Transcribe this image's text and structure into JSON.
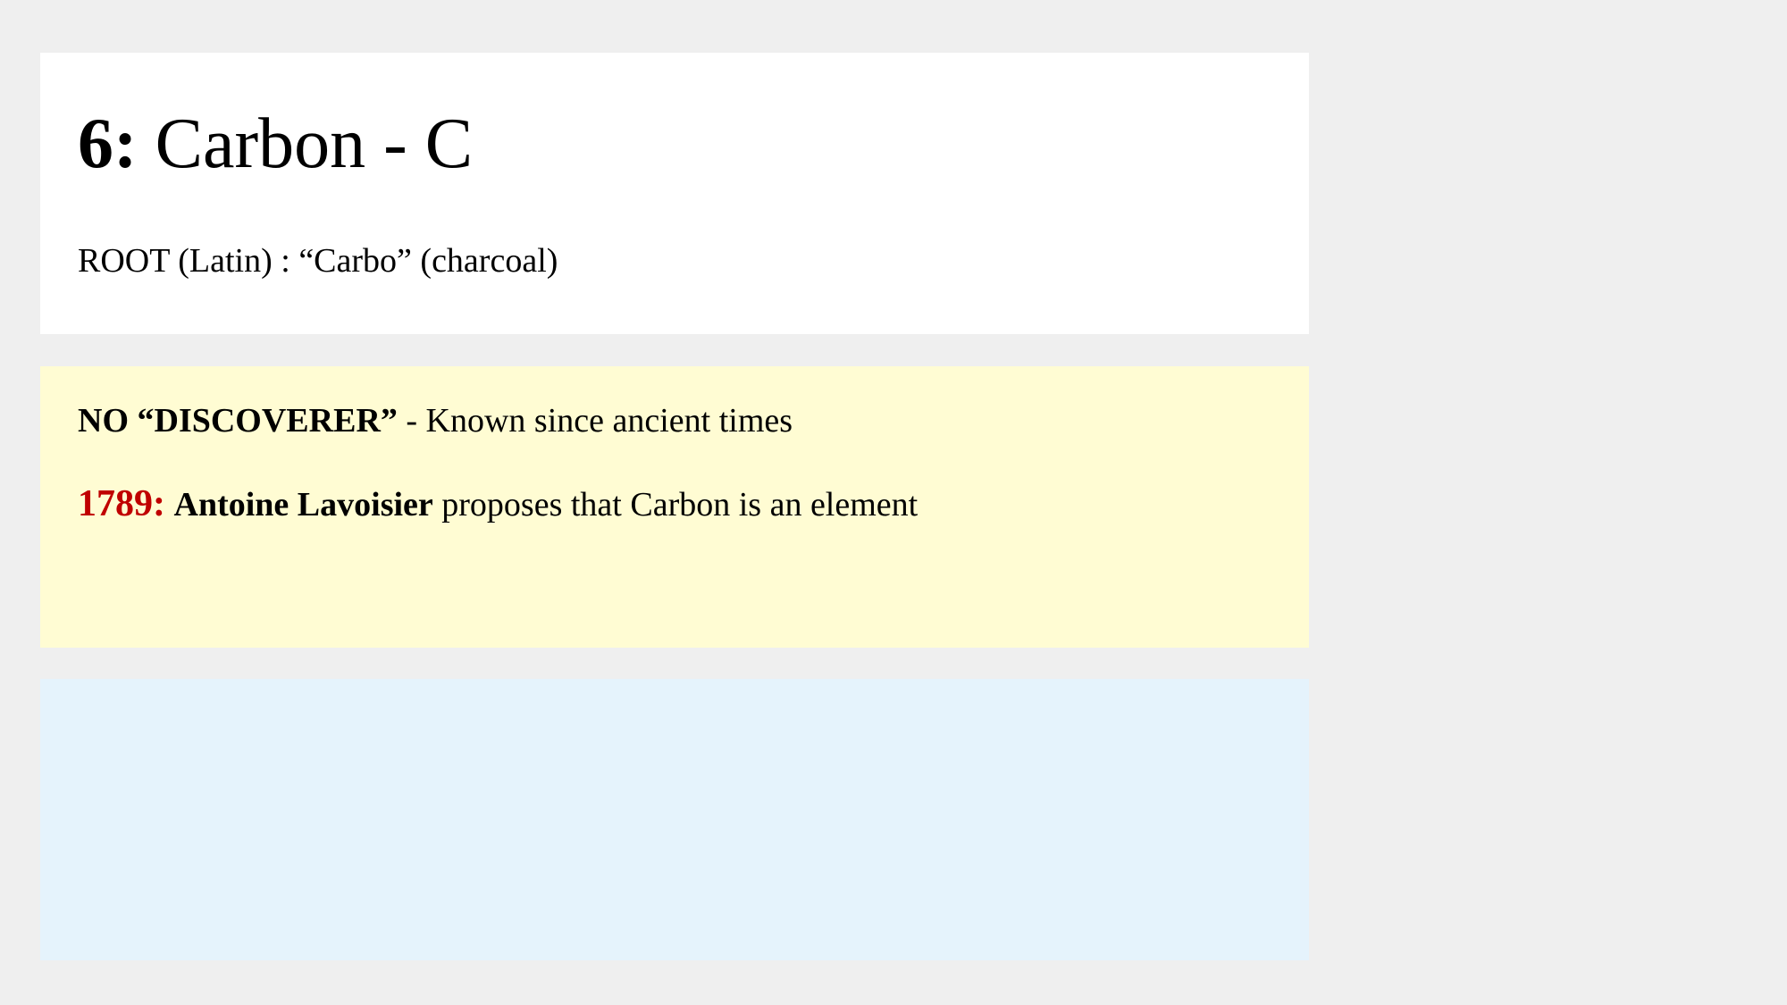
{
  "title_panel": {
    "number": "6:",
    "element": "Carbon - C",
    "root": "ROOT (Latin) : “Carbo” (charcoal)"
  },
  "discovery_panel": {
    "discoverer_label": "NO “DISCOVERER”",
    "discoverer_rest": " - Known since ancient times",
    "year": "1789:",
    "person": "Antoine Lavoisier",
    "event": " proposes that Carbon is an element"
  },
  "colors": {
    "background": "#efefef",
    "title_panel": "#ffffff",
    "discovery_panel": "#fffcd3",
    "empty_panel": "#e5f3fc",
    "year_accent": "#c00000"
  }
}
